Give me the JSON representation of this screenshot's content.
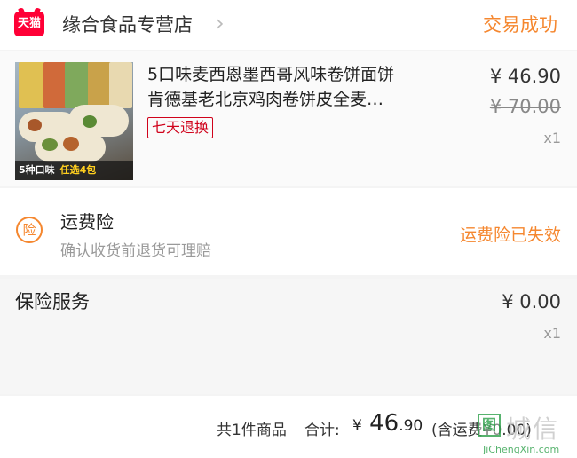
{
  "header": {
    "brand_badge": "天猫",
    "shop_name": "缘合食品专营店",
    "order_status": "交易成功"
  },
  "product": {
    "title_line1": "5口味麦西恩墨西哥风味卷饼面饼",
    "title_line2": "肯德基老北京鸡肉卷饼皮全麦…",
    "tag": "七天退换",
    "price": "¥ 46.90",
    "original_price": "¥ 70.00",
    "quantity": "x1",
    "thumb_caption_main": "5种口味",
    "thumb_caption_highlight": "任选4包"
  },
  "freight_insurance": {
    "icon_char": "险",
    "title": "运费险",
    "description": "确认收货前退货可理赔",
    "status": "运费险已失效"
  },
  "insurance_service": {
    "title": "保险服务",
    "price": "¥ 0.00",
    "quantity": "x1"
  },
  "summary": {
    "item_count": "共1件商品",
    "total_label": "合计:",
    "total_currency": "¥",
    "total_main": "46",
    "total_decimal": ".90",
    "freight_note": "(含运费¥0.00)"
  },
  "watermark": {
    "box_char": "图",
    "text": "城信",
    "url": "JiChengXin.com"
  },
  "colors": {
    "accent_orange": "#f5872f",
    "tmall_red": "#ff0036",
    "tag_red": "#d0021b"
  }
}
